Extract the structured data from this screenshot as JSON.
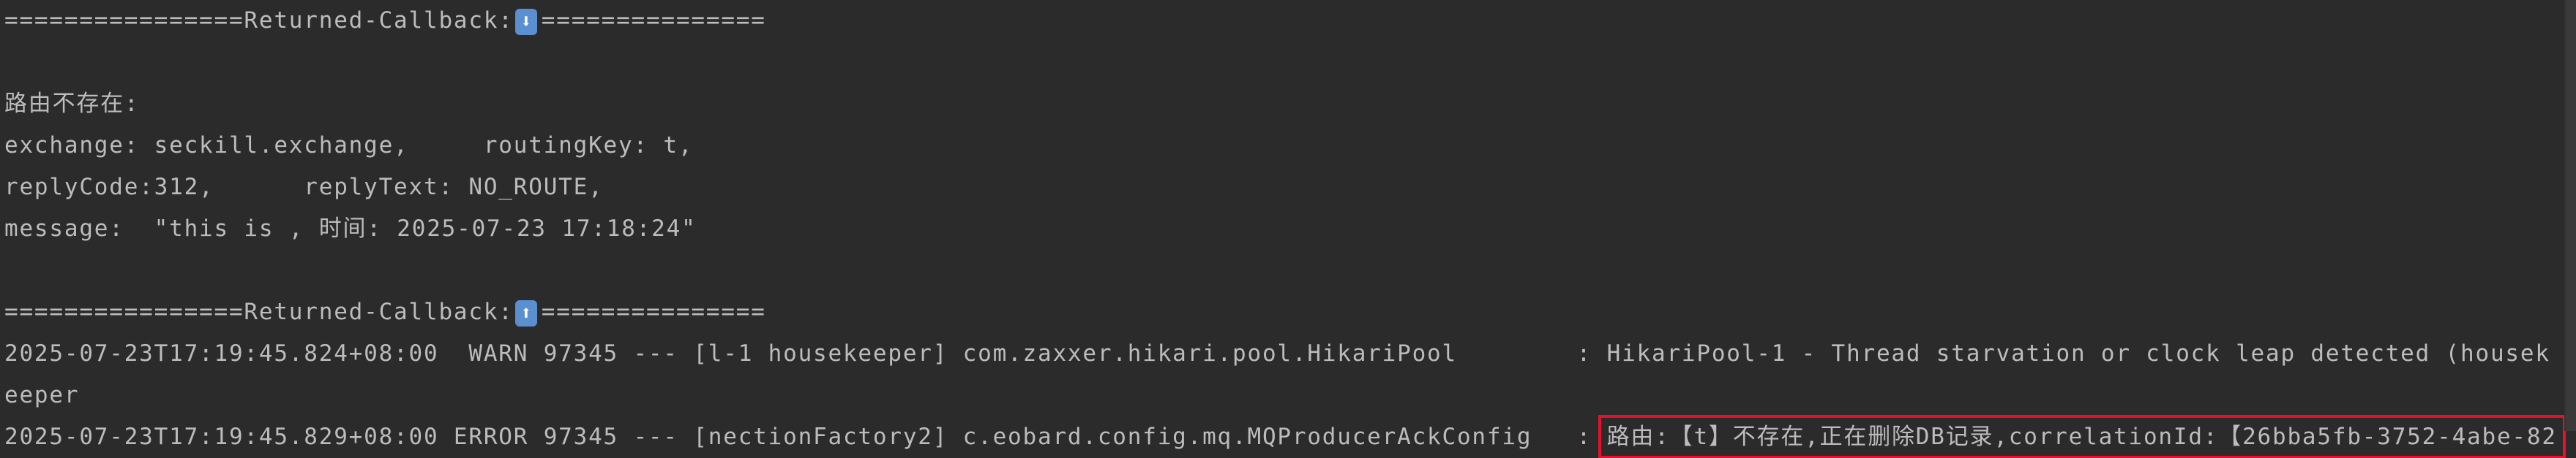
{
  "console": {
    "callback_down": {
      "prefix": "================Returned-Callback:",
      "icon": "⬇",
      "suffix": "==============="
    },
    "route_missing_label": "路由不存在:",
    "exchange_line": "exchange: seckill.exchange,     routingKey: t,",
    "reply_line": "replyCode:312,      replyText: NO_ROUTE,",
    "message_line": "message:  \"this is , 时间: 2025-07-23 17:18:24\"",
    "callback_up": {
      "prefix": "================Returned-Callback:",
      "icon": "⬆",
      "suffix": "==============="
    },
    "log_lines": [
      {
        "text": "2025-07-23T17:19:45.824+08:00  WARN 97345 --- [l-1 housekeeper] com.zaxxer.hikari.pool.HikariPool        : HikariPool-1 - Thread starvation or clock leap detected (housekeeper"
      },
      {
        "prefix": "2025-07-23T17:19:45.829+08:00 ERROR 97345 --- [nectionFactory2] c.eobard.config.mq.MQProducerAckConfig   : ",
        "message": "路由:【t】不存在,正在删除DB记录,correlationId:【26bba5fb-3752-4abe-82"
      }
    ]
  },
  "colors": {
    "background": "#2b2b2b",
    "text": "#bcbcbc",
    "highlight_border": "#e8102a"
  }
}
